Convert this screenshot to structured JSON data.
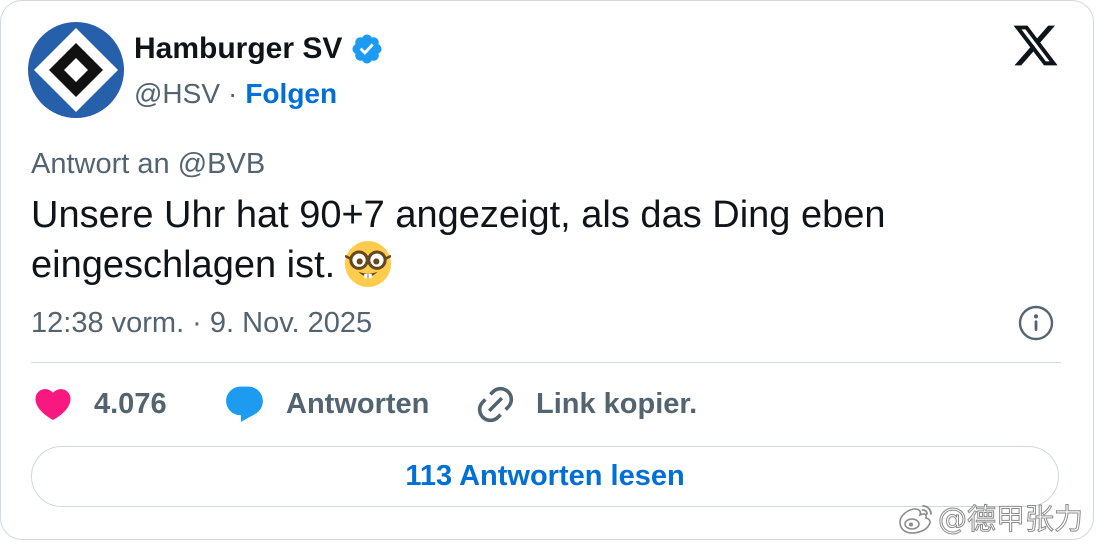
{
  "colors": {
    "text_primary": "#0f1419",
    "text_secondary": "#536471",
    "link_blue": "#006fd6",
    "verified_blue": "#1d9bf0",
    "reply_icon_blue": "#1d9bf0",
    "like_pink": "#f91880",
    "border": "#cfd9de",
    "avatar_blue": "#2660ab"
  },
  "post": {
    "author": {
      "avatar_icon": "hsv-crest-avatar",
      "display_name": "Hamburger SV",
      "verified_icon": "verified-badge-icon",
      "handle": "@HSV",
      "separator": "·",
      "follow_label": "Folgen"
    },
    "brand_icon": "x-logo-icon",
    "reply_context": {
      "prefix": "Antwort an",
      "mention": "@BVB"
    },
    "text": "Unsere Uhr hat 90+7 angezeigt, als das Ding eben eingeschlagen ist.",
    "text_emoji_icon": "nerd-face-emoji",
    "timestamp": "12:38 vorm. · 9. Nov. 2025",
    "info_icon": "info-icon",
    "actions": {
      "like_icon": "heart-icon",
      "like_count": "4.076",
      "reply_icon": "speech-bubble-icon",
      "reply_label": "Antworten",
      "copy_link_icon": "link-icon",
      "copy_link_label": "Link kopier."
    },
    "read_replies_label": "113 Antworten lesen"
  },
  "watermark": {
    "icon": "weibo-logo-icon",
    "text": "@德甲张力"
  }
}
